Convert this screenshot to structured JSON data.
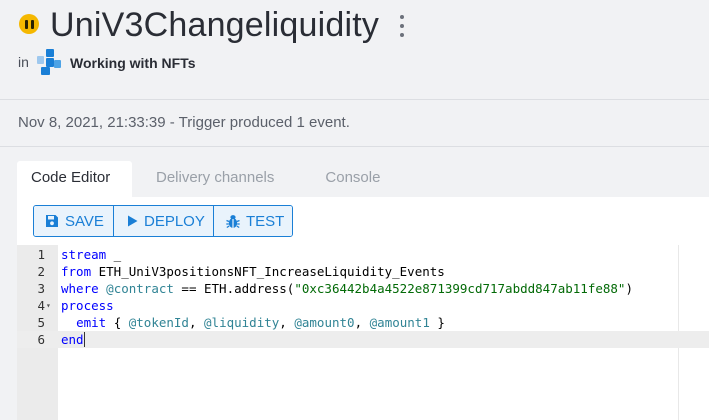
{
  "header": {
    "title": "UniV3Changeliquidity",
    "in_label": "in",
    "project_name": "Working with NFTs"
  },
  "status_line": "Nov 8, 2021, 21:33:39 - Trigger produced 1 event.",
  "tabs": [
    {
      "label": "Code Editor",
      "active": true
    },
    {
      "label": "Delivery channels",
      "active": false
    },
    {
      "label": "Console",
      "active": false
    }
  ],
  "toolbar": {
    "save_label": "SAVE",
    "deploy_label": "DEPLOY",
    "test_label": "TEST"
  },
  "editor": {
    "line_numbers": [
      "1",
      "2",
      "3",
      "4",
      "5",
      "6"
    ],
    "lines": [
      [
        {
          "t": "kw",
          "v": "stream"
        },
        {
          "t": "plain",
          "v": " _"
        }
      ],
      [
        {
          "t": "kw",
          "v": "from"
        },
        {
          "t": "plain",
          "v": " ETH_UniV3positionsNFT_IncreaseLiquidity_Events"
        }
      ],
      [
        {
          "t": "kw",
          "v": "where"
        },
        {
          "t": "plain",
          "v": " "
        },
        {
          "t": "var",
          "v": "@contract"
        },
        {
          "t": "plain",
          "v": " == ETH.address("
        },
        {
          "t": "str",
          "v": "\"0xc36442b4a4522e871399cd717abdd847ab11fe88\""
        },
        {
          "t": "plain",
          "v": ")"
        }
      ],
      [
        {
          "t": "kw",
          "v": "process"
        }
      ],
      [
        {
          "t": "plain",
          "v": "  "
        },
        {
          "t": "kw",
          "v": "emit"
        },
        {
          "t": "plain",
          "v": " { "
        },
        {
          "t": "var",
          "v": "@tokenId"
        },
        {
          "t": "plain",
          "v": ", "
        },
        {
          "t": "var",
          "v": "@liquidity"
        },
        {
          "t": "plain",
          "v": ", "
        },
        {
          "t": "var",
          "v": "@amount0"
        },
        {
          "t": "plain",
          "v": ", "
        },
        {
          "t": "var",
          "v": "@amount1"
        },
        {
          "t": "plain",
          "v": " }"
        }
      ],
      [
        {
          "t": "kw",
          "v": "end"
        }
      ]
    ],
    "fold_line_index": 3,
    "active_line_index": 5
  },
  "colors": {
    "status_dot": "#f5b800",
    "accent": "#1a7fd6",
    "keyword": "#0000ff",
    "string": "#036a07",
    "variable": "#318495"
  },
  "icons": {
    "status": "pause-icon",
    "more": "kebab-menu-icon",
    "project": "project-logo-icon",
    "save": "floppy-disk-icon",
    "deploy": "play-icon",
    "test": "bug-icon"
  }
}
